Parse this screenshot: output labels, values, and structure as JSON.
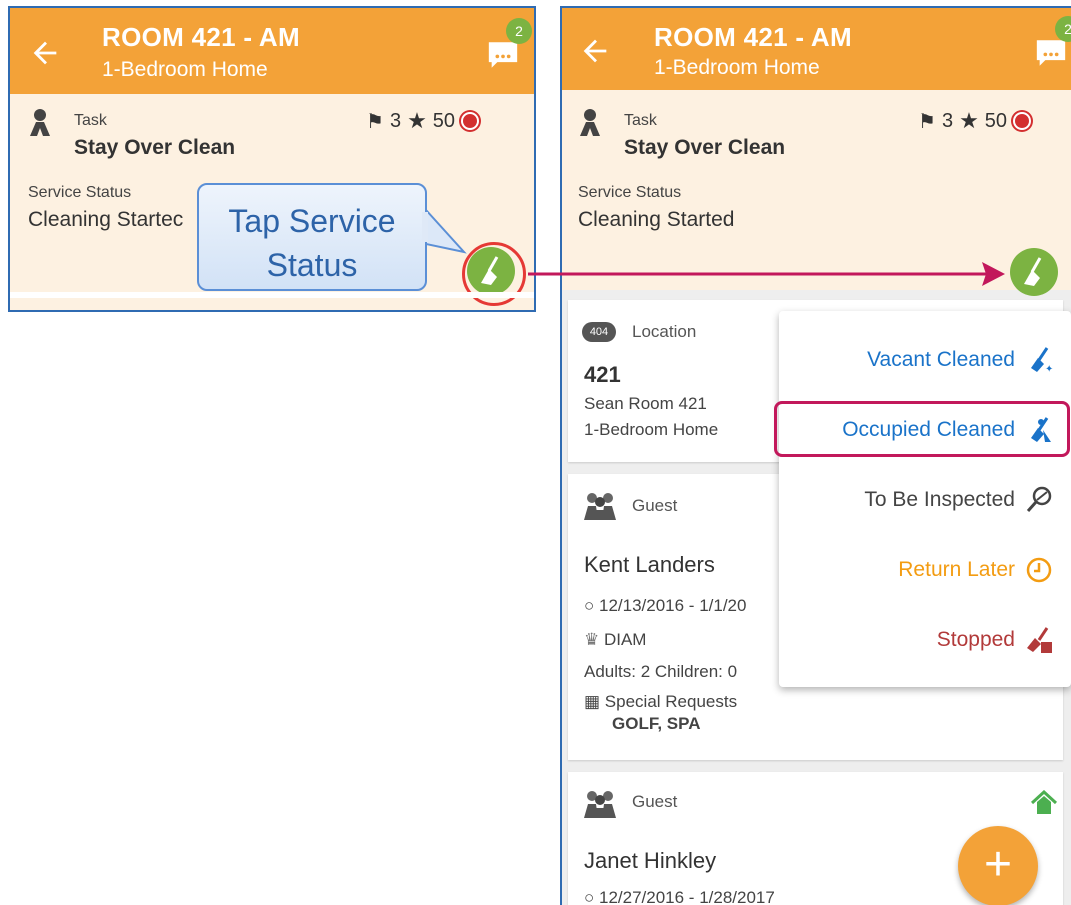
{
  "header": {
    "title": "ROOM 421 - AM",
    "subtitle": "1-Bedroom Home",
    "notification_count": "2"
  },
  "task": {
    "label": "Task",
    "value": "Stay Over Clean",
    "flags": "3",
    "stars": "50"
  },
  "service": {
    "label": "Service Status",
    "value": "Cleaning Started",
    "value_truncated": "Cleaning Startec"
  },
  "callout": {
    "line1": "Tap Service",
    "line2": "Status"
  },
  "location": {
    "badge": "404",
    "label": "Location",
    "number": "421",
    "line1": "Sean Room 421",
    "line2": "1-Bedroom Home"
  },
  "guest1": {
    "label": "Guest",
    "name": "Kent Landers",
    "dates": "12/13/2016 - 1/1/20",
    "tier": "DIAM",
    "occupancy": "Adults: 2 Children: 0",
    "requests_label": "Special Requests",
    "requests": "GOLF, SPA"
  },
  "guest2": {
    "label": "Guest",
    "name": "Janet Hinkley",
    "dates": "12/27/2016 - 1/28/2017"
  },
  "menu": {
    "items": [
      {
        "label": "Vacant Cleaned",
        "color": "#1a73c9",
        "icon": "vacant-cleaned-icon"
      },
      {
        "label": "Occupied Cleaned",
        "color": "#1a73c9",
        "icon": "occupied-cleaned-icon"
      },
      {
        "label": "To Be Inspected",
        "color": "#444444",
        "icon": "inspect-icon"
      },
      {
        "label": "Return Later",
        "color": "#f39c12",
        "icon": "clock-icon"
      },
      {
        "label": "Stopped",
        "color": "#b23a3a",
        "icon": "stopped-icon"
      }
    ]
  },
  "add_button": "+",
  "colors": {
    "appbar": "#f3a238",
    "status_green": "#7cb342",
    "highlight": "#c2185b",
    "panel_border": "#2f6bb2"
  }
}
